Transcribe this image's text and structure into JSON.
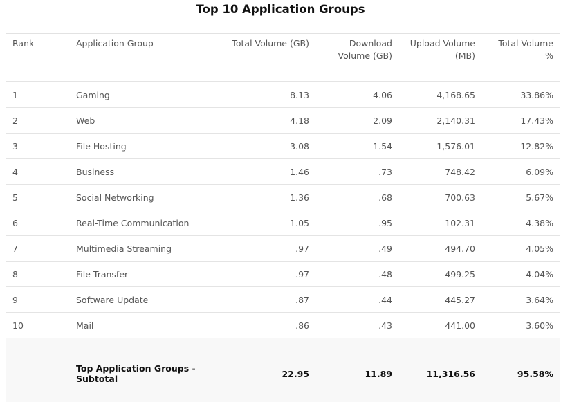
{
  "title": "Top 10 Application Groups",
  "columns": [
    "Rank",
    "Application Group",
    "Total Volume (GB)",
    "Download Volume (GB)",
    "Upload Volume (MB)",
    "Total Volume %"
  ],
  "rows": [
    {
      "rank": "1",
      "group": "Gaming",
      "total": "8.13",
      "download": "4.06",
      "upload": "4,168.65",
      "pct": "33.86%"
    },
    {
      "rank": "2",
      "group": "Web",
      "total": "4.18",
      "download": "2.09",
      "upload": "2,140.31",
      "pct": "17.43%"
    },
    {
      "rank": "3",
      "group": "File Hosting",
      "total": "3.08",
      "download": "1.54",
      "upload": "1,576.01",
      "pct": "12.82%"
    },
    {
      "rank": "4",
      "group": "Business",
      "total": "1.46",
      "download": ".73",
      "upload": "748.42",
      "pct": "6.09%"
    },
    {
      "rank": "5",
      "group": "Social Networking",
      "total": "1.36",
      "download": ".68",
      "upload": "700.63",
      "pct": "5.67%"
    },
    {
      "rank": "6",
      "group": "Real-Time Communication",
      "total": "1.05",
      "download": ".95",
      "upload": "102.31",
      "pct": "4.38%"
    },
    {
      "rank": "7",
      "group": "Multimedia Streaming",
      "total": ".97",
      "download": ".49",
      "upload": "494.70",
      "pct": "4.05%"
    },
    {
      "rank": "8",
      "group": "File Transfer",
      "total": ".97",
      "download": ".48",
      "upload": "499.25",
      "pct": "4.04%"
    },
    {
      "rank": "9",
      "group": "Software Update",
      "total": ".87",
      "download": ".44",
      "upload": "445.27",
      "pct": "3.64%"
    },
    {
      "rank": "10",
      "group": "Mail",
      "total": ".86",
      "download": ".43",
      "upload": "441.00",
      "pct": "3.60%"
    }
  ],
  "subtotal": {
    "label": "Top Application Groups - Subtotal",
    "total": "22.95",
    "download": "11.89",
    "upload": "11,316.56",
    "pct": "95.58%"
  }
}
